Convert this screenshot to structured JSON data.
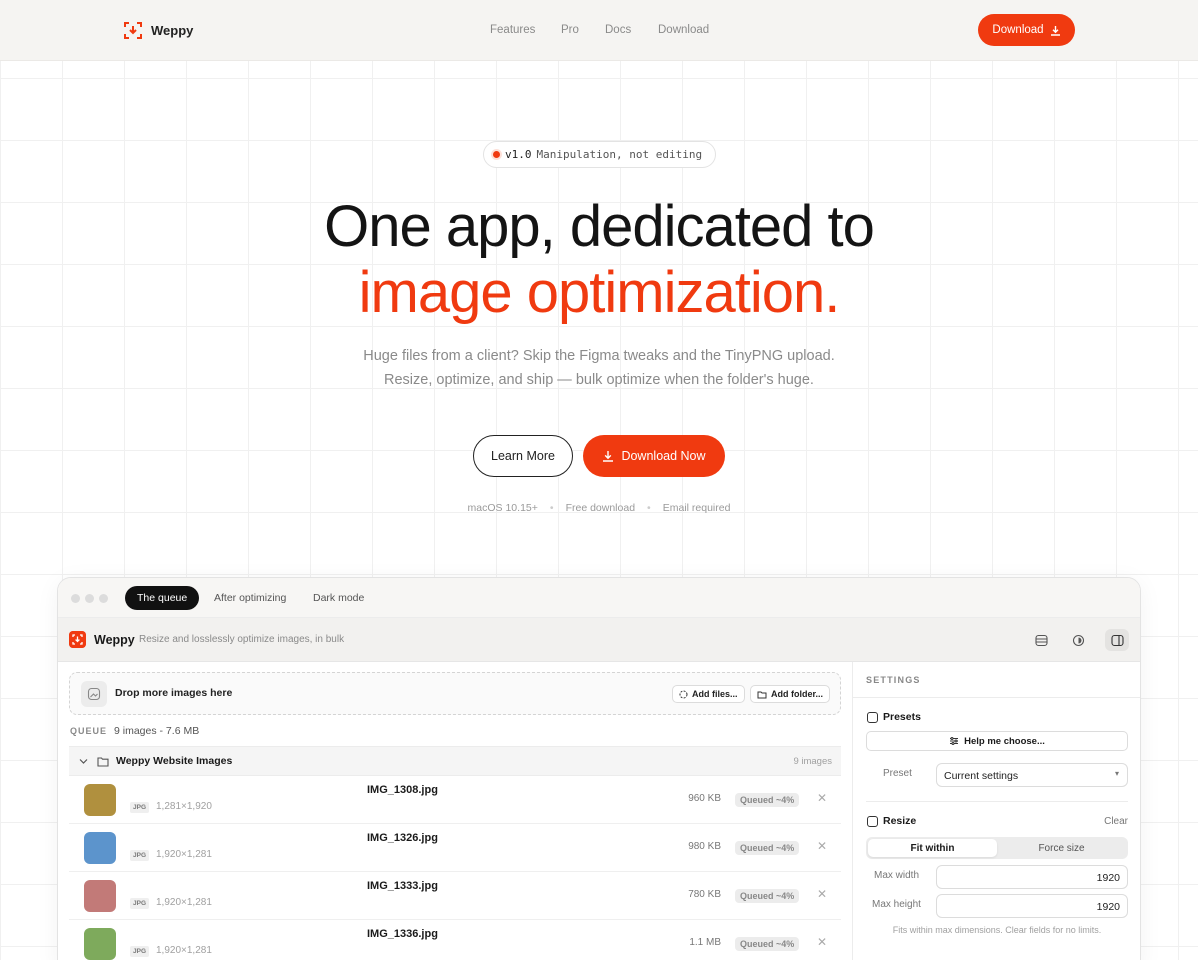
{
  "nav": {
    "brand": "Weppy",
    "links": [
      "Features",
      "Pro",
      "Docs",
      "Download"
    ],
    "download_label": "Download"
  },
  "hero": {
    "badge_version": "v1.0",
    "badge_text": "Manipulation, not editing",
    "headline_line1": "One app, dedicated to",
    "headline_line2": "image optimization.",
    "sub_line1": "Huge files from a client? Skip the Figma tweaks and the TinyPNG upload.",
    "sub_line2": "Resize, optimize, and ship — bulk optimize when the folder's huge.",
    "learn_more": "Learn More",
    "download_now": "Download Now",
    "meta": [
      "macOS 10.15+",
      "Free download",
      "Email required"
    ]
  },
  "app": {
    "tabs": [
      "The queue",
      "After optimizing",
      "Dark mode"
    ],
    "active_tab": 0,
    "name": "Weppy",
    "tagline": "Resize and losslessly optimize images, in bulk",
    "drop_text": "Drop more images here",
    "add_files": "Add files...",
    "add_folder": "Add folder...",
    "queue_label": "QUEUE",
    "queue_count": "9 images - 7.6 MB",
    "group_name": "Weppy Website Images",
    "group_count": "9 images",
    "files": [
      {
        "name": "IMG_1308.jpg",
        "format": "JPG",
        "dims": "1,281×1,920",
        "size": "960 KB",
        "status": "Queued ~4%",
        "color": "#b0903e"
      },
      {
        "name": "IMG_1326.jpg",
        "format": "JPG",
        "dims": "1,920×1,281",
        "size": "980 KB",
        "status": "Queued ~4%",
        "color": "#5c94cc"
      },
      {
        "name": "IMG_1333.jpg",
        "format": "JPG",
        "dims": "1,920×1,281",
        "size": "780 KB",
        "status": "Queued ~4%",
        "color": "#c27a78"
      },
      {
        "name": "IMG_1336.jpg",
        "format": "JPG",
        "dims": "1,920×1,281",
        "size": "1.1 MB",
        "status": "Queued ~4%",
        "color": "#7eaa5c"
      }
    ],
    "settings": {
      "title": "SETTINGS",
      "presets_title": "Presets",
      "help_button": "Help me choose...",
      "preset_label": "Preset",
      "preset_value": "Current settings",
      "resize_title": "Resize",
      "clear": "Clear",
      "mode_on": "Fit within",
      "mode_off": "Force size",
      "max_width_label": "Max width",
      "max_width": "1920",
      "max_height_label": "Max height",
      "max_height": "1920",
      "hint": "Fits within max dimensions. Clear fields for no limits."
    }
  },
  "colors": {
    "accent": "#f03a10"
  }
}
